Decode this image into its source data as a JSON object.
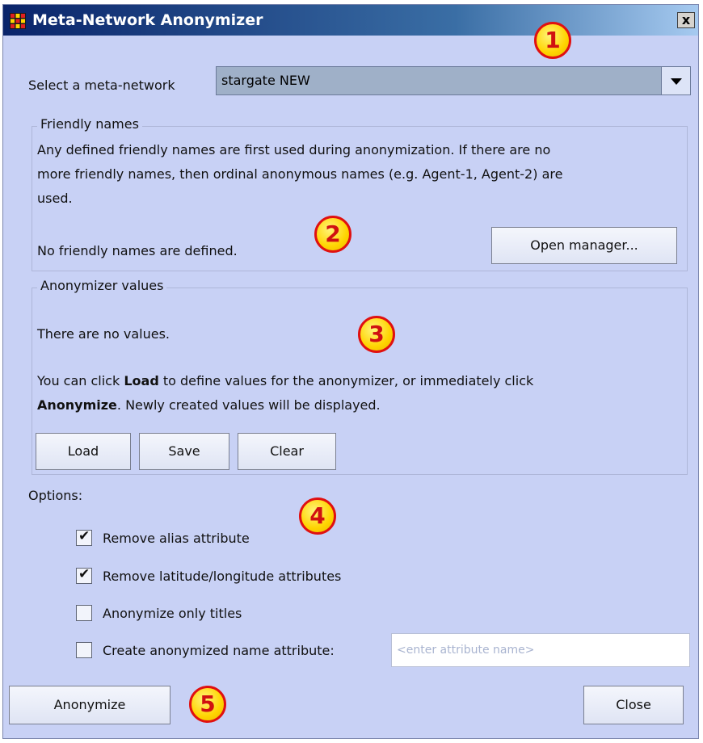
{
  "window": {
    "title": "Meta-Network Anonymizer",
    "close_glyph": "x"
  },
  "select": {
    "label": "Select a meta-network",
    "value": "stargate NEW"
  },
  "friendly": {
    "title": "Friendly names",
    "description_line1": "Any defined friendly names are first used during anonymization. If there are no",
    "description_line2": "more friendly names, then ordinal anonymous names (e.g. Agent-1, Agent-2) are",
    "description_line3": "used.",
    "status": "No friendly names are defined.",
    "open_manager": "Open manager..."
  },
  "values": {
    "title": "Anonymizer values",
    "status": "There are no values.",
    "hint_prefix": "You can click ",
    "hint_load": "Load",
    "hint_middle": " to define values for the anonymizer, or immediately click",
    "hint_anonymize": "Anonymize",
    "hint_suffix": ". Newly created values will be displayed.",
    "load_button": "Load",
    "save_button": "Save",
    "clear_button": "Clear"
  },
  "options": {
    "label": "Options:",
    "items": [
      {
        "label": "Remove alias attribute",
        "checked": true
      },
      {
        "label": "Remove latitude/longitude attributes",
        "checked": true
      },
      {
        "label": "Anonymize only titles",
        "checked": false
      },
      {
        "label": "Create anonymized name attribute:",
        "checked": false
      }
    ],
    "attribute_placeholder": "<enter attribute name>"
  },
  "footer": {
    "anonymize_button": "Anonymize",
    "close_button": "Close"
  },
  "callouts": [
    "1",
    "2",
    "3",
    "4",
    "5"
  ],
  "colors": {
    "window_bg": "#c8d1f5",
    "title_bar": "#0a246a",
    "callout_fill": "#ffd400",
    "callout_border": "#e01010"
  },
  "icons": {
    "app": "grid-app-icon",
    "close": "close-icon",
    "dropdown": "chevron-down-icon",
    "check": "checkmark-icon"
  }
}
